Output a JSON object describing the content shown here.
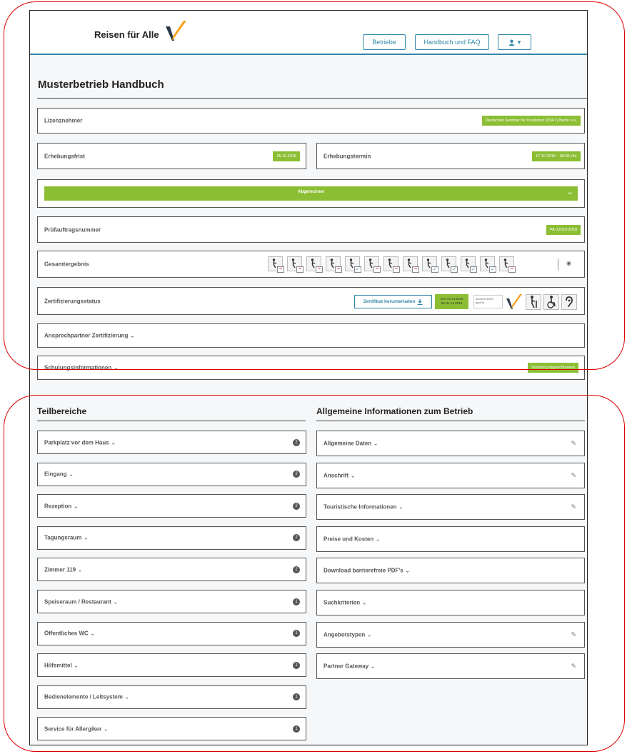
{
  "header": {
    "logo_text": "Reisen für Alle",
    "nav": [
      "Betriebe",
      "Handbuch und FAQ"
    ],
    "user_caret": "▾"
  },
  "page": {
    "title": "Musterbetrieb Handbuch"
  },
  "fields": {
    "lizenznehmer": {
      "label": "Lizenznehmer",
      "value": "Deutsches Seminar für Tourismus (DSFT) Berlin e.V."
    },
    "erhebungsfrist": {
      "label": "Erhebungsfrist",
      "value": "25.10.2018"
    },
    "erhebungstermin": {
      "label": "Erhebungstermin",
      "value": "17.10.2018 – 09:00 Uhr"
    },
    "status_bar": {
      "label": "Abgerechnet",
      "chevron": "⌄"
    },
    "pruefauftrag": {
      "label": "Prüfauftragsnummer",
      "value": "PA-12023-2018"
    },
    "gesamtergebnis": {
      "label": "Gesamtergebnis",
      "eye_icon": "◉"
    },
    "zertifizierung": {
      "label": "Zertifizierungsstatus",
      "download_label": "Zertifikat herunterladen",
      "period_line1": "vom 01.01.2016",
      "period_line2": "bis 31.12.2018",
      "barrier_text": "Barrierefreiheit geprüft"
    },
    "ansprechpartner": {
      "label": "Ansprechpartner Zertifizierung"
    },
    "schulung": {
      "label": "Schulungsinformationen",
      "badge": "Schulung abgeschlossen"
    }
  },
  "teilbereiche": {
    "title": "Teilbereiche",
    "items": [
      {
        "label": "Parkplatz vor dem Haus",
        "count": "2"
      },
      {
        "label": "Eingang",
        "count": "2"
      },
      {
        "label": "Rezeption",
        "count": "2"
      },
      {
        "label": "Tagungsraum",
        "count": "2"
      },
      {
        "label": "Zimmer 119",
        "count": "2"
      },
      {
        "label": "Speiseraum / Restaurant",
        "count": "1"
      },
      {
        "label": "Öffentliches WC",
        "count": "1"
      },
      {
        "label": "Hilfsmittel",
        "count": "1"
      },
      {
        "label": "Bedienelemente / Leitsystem",
        "count": "1"
      },
      {
        "label": "Service für Allergiker",
        "count": "1"
      }
    ]
  },
  "allgemein": {
    "title": "Allgemeine Informationen zum Betrieb",
    "items": [
      {
        "label": "Allgemeine Daten",
        "editable": true
      },
      {
        "label": "Anschrift",
        "editable": true
      },
      {
        "label": "Touristische Informationen",
        "editable": true
      },
      {
        "label": "Preise und Kosten",
        "editable": false
      },
      {
        "label": "Download barrierefreie PDF's",
        "editable": false
      },
      {
        "label": "Suchkriterien",
        "editable": false
      },
      {
        "label": "Angebotstypen",
        "editable": true
      },
      {
        "label": "Partner Gateway",
        "editable": true
      }
    ]
  },
  "icon_marks": [
    "minus",
    "minus",
    "minus",
    "minus",
    "check",
    "minus",
    "minus",
    "minus",
    "check",
    "check",
    "check",
    "check",
    "minus"
  ],
  "colors": {
    "accent": "#2f86a6",
    "green": "#8cbe34",
    "highlight": "#dd0000"
  }
}
